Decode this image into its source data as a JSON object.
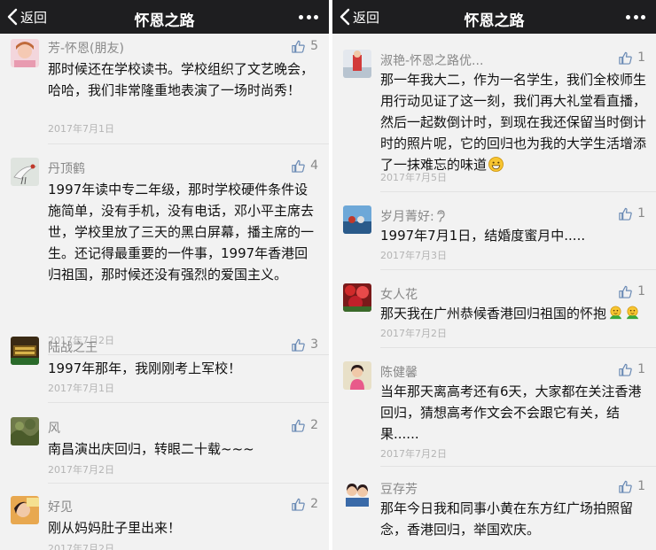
{
  "left_panel": {
    "back_label": "返回",
    "title": "怀恩之路",
    "comments": [
      {
        "name": "芳-怀恩(朋友)",
        "likes": "5",
        "text": "那时候还在学校读书。学校组织了文艺晚会，哈哈，我们非常隆重地表演了一场时尚秀！",
        "date": "2017年7月1日"
      },
      {
        "name": "丹顶鹤",
        "likes": "4",
        "text": "1997年读中专二年级，那时学校硬件条件设施简单，没有手机，没有电话，邓小平主席去世，学校里放了三天的黑白屏幕，播主席的一生。还记得最重要的一件事，1997年香港回归祖国，那时候还没有强烈的爱国主义。",
        "date": "2017年7月2日"
      },
      {
        "name": "陆战之王",
        "likes": "3",
        "text": "1997年那年，我刚刚考上军校！",
        "date": "2017年7月1日"
      },
      {
        "name": "风",
        "likes": "2",
        "text": "南昌演出庆回归，转眼二十载~~~",
        "date": "2017年7月2日"
      },
      {
        "name": "好见",
        "likes": "2",
        "text": "刚从妈妈肚子里出来！",
        "date": "2017年7月2日"
      }
    ]
  },
  "right_panel": {
    "back_label": "返回",
    "title": "怀恩之路",
    "comments": [
      {
        "name": "淑艳-怀恩之路优...",
        "likes": "1",
        "text": "那一年我大二，作为一名学生，我们全校师生用行动见证了这一刻，我们再大礼堂看直播，然后一起数倒计时，到现在我还保留当时倒计时的照片呢，它的回归也为我的大学生活增添了一抹难忘的味道",
        "date": "2017年7月5日"
      },
      {
        "name": "岁月菁好:",
        "likes": "1",
        "text": "1997年7月1日，结婚度蜜月中.....",
        "date": "2017年7月3日"
      },
      {
        "name": "女人花",
        "likes": "1",
        "text": "那天我在广州恭候香港回归祖国的怀抱",
        "date": "2017年7月2日"
      },
      {
        "name": "陈健馨",
        "likes": "1",
        "text": "当年那天离高考还有6天，大家都在关注香港回归，猜想高考作文会不会跟它有关，结果......",
        "date": "2017年7月2日"
      },
      {
        "name": "豆存芳",
        "likes": "1",
        "text": "那年今日我和同事小黄在东方红广场拍照留念，香港回归，举国欢庆。",
        "date": ""
      }
    ]
  },
  "icons": {
    "back": "chevron-left-icon",
    "more": "more-dots-icon",
    "like": "thumbs-up-icon",
    "smile_emoji": "grin-emoji-icon",
    "hug_emoji": "hug-emoji-icon",
    "name_glyph": "ear-glyph-icon"
  },
  "colors": {
    "navbar_bg": "#1e1e20",
    "page_bg": "#f2f2f2",
    "name_text": "#888888",
    "body_text": "#111111",
    "date_text": "#b4b4b4",
    "like_icon": "#6b8bb5"
  }
}
